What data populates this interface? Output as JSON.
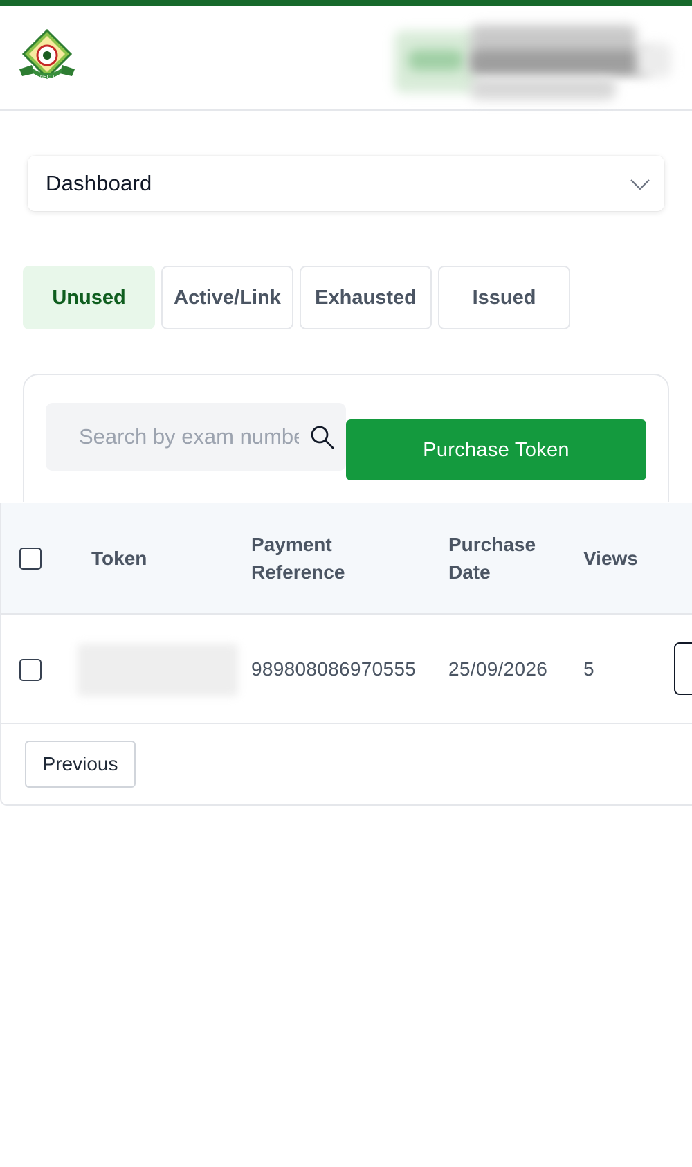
{
  "colors": {
    "brand_dark_green": "#17692b",
    "button_green": "#149a3e",
    "active_tab_bg": "#e8f7ea",
    "active_tab_text": "#0f5e1f"
  },
  "header": {
    "logo_icon": "neco-logo-icon",
    "user_info_blurred": true
  },
  "nav": {
    "select_label": "Dashboard",
    "select_icon": "chevron-down-icon"
  },
  "tabs": [
    {
      "label": "Unused",
      "active": true
    },
    {
      "label": "Active/Link",
      "active": false
    },
    {
      "label": "Exhausted",
      "active": false
    },
    {
      "label": "Issued",
      "active": false
    }
  ],
  "search": {
    "placeholder": "Search by exam number",
    "icon": "search-icon"
  },
  "purchase_button": "Purchase Token",
  "table": {
    "headers": {
      "token": "Token",
      "payment_reference_line1": "Payment",
      "payment_reference_line2": "Reference",
      "purchase_date_line1": "Purchase",
      "purchase_date_line2": "Date",
      "views": "Views"
    },
    "rows": [
      {
        "token": "",
        "payment_reference": "989808086970555",
        "purchase_date": "25/09/2026",
        "views": "5"
      }
    ]
  },
  "pagination": {
    "previous_label": "Previous"
  }
}
